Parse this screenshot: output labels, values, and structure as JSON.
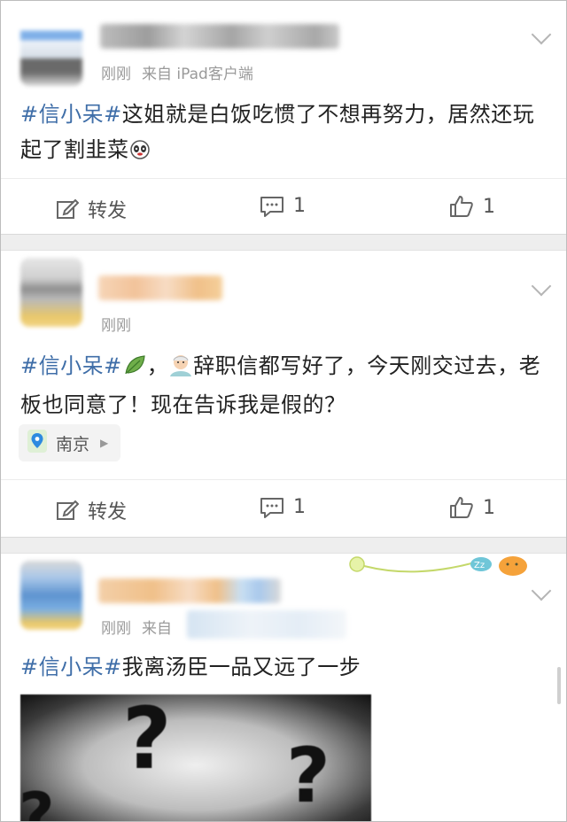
{
  "posts": [
    {
      "time": "刚刚",
      "source": "来自 iPad客户端",
      "text_tag": "#信小呆#",
      "text": "这姐就是白饭吃惯了不想再努力，居然还玩起了割韭菜",
      "actions": {
        "repost_label": "转发",
        "comment_count": "1",
        "like_count": "1"
      }
    },
    {
      "time": "刚刚",
      "text_tag": "#信小呆#",
      "text_mid": "，",
      "text": "辞职信都写好了，今天刚交过去，老板也同意了！现在告诉我是假的？",
      "location": "南京",
      "actions": {
        "repost_label": "转发",
        "comment_count": "1",
        "like_count": "1"
      }
    },
    {
      "time": "刚刚",
      "source": "来自",
      "text_tag": "#信小呆#",
      "text": "我离汤臣一品又远了一步"
    }
  ],
  "colors": {
    "hashtag": "#3f6ea8",
    "meta": "#9a9a9a",
    "separator": "#eeeeee"
  },
  "icons": [
    "edit-icon",
    "comment-icon",
    "thumbs-up-icon",
    "location-pin-icon",
    "chevron-down-icon",
    "leaf-emoji",
    "old-man-emoji",
    "panda-emoji"
  ]
}
